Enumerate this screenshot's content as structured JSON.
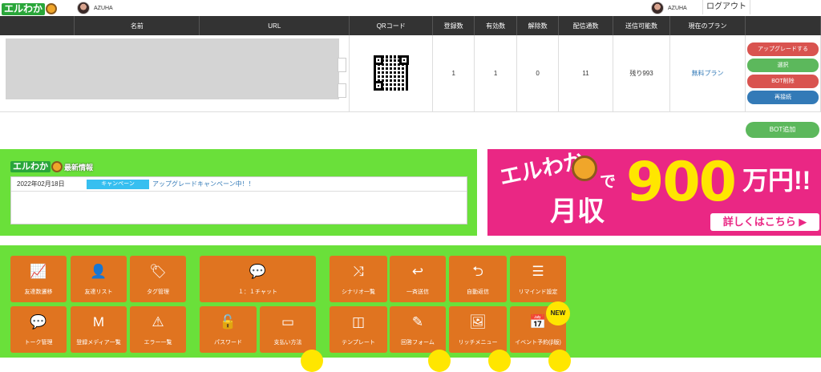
{
  "header": {
    "logo_text": "エルわか",
    "user_left": "AZUHA",
    "user_right": "AZUHA",
    "logout_label": "ログアウト"
  },
  "table": {
    "columns": [
      "名前",
      "URL",
      "QRコード",
      "登録数",
      "有効数",
      "解除数",
      "配信通数",
      "送信可能数",
      "現在のプラン"
    ],
    "row": {
      "registered": "1",
      "active": "1",
      "unsubscribed": "0",
      "deliveries": "11",
      "remaining": "残り993",
      "plan": "無料プラン"
    },
    "actions": {
      "upgrade": "アップグレードする",
      "select": "選択",
      "delete": "BOT削除",
      "reconnect": "再接続"
    },
    "add_bot": "BOT追加"
  },
  "news": {
    "logo_text": "エルわか",
    "title": "最新情報",
    "items": [
      {
        "date": "2022年02月18日",
        "tag": "キャンペーン",
        "text": "アップグレードキャンペーン中！！"
      }
    ]
  },
  "banner": {
    "line1": "エルわか",
    "de": "で",
    "income": "月収",
    "amount": "900",
    "unit": "万円!!",
    "cta": "詳しくはこちら ▶"
  },
  "menu": {
    "tiles": [
      {
        "label": "友達数遷移",
        "icon": "chart-line-icon"
      },
      {
        "label": "友達リスト",
        "icon": "person-icon"
      },
      {
        "label": "タグ管理",
        "icon": "tags-icon"
      },
      {
        "label": "１：１チャット",
        "icon": "chat-bubble-icon"
      },
      {
        "label": "シナリオ一覧",
        "icon": "shuffle-icon"
      },
      {
        "label": "一斉送信",
        "icon": "reply-icon"
      },
      {
        "label": "自動返信",
        "icon": "undo-arrow-icon"
      },
      {
        "label": "リマインド設定",
        "icon": "list-icon"
      },
      {
        "label": "トーク管理",
        "icon": "comment-icon"
      },
      {
        "label": "登録メディア一覧",
        "icon": "media-icon"
      },
      {
        "label": "エラー一覧",
        "icon": "warning-icon"
      },
      {
        "label": "パスワード",
        "icon": "unlock-icon"
      },
      {
        "label": "支払い方法",
        "icon": "card-icon"
      },
      {
        "label": "テンプレート",
        "icon": "columns-icon"
      },
      {
        "label": "回答フォーム",
        "icon": "form-icon"
      },
      {
        "label": "リッチメニュー",
        "icon": "image-icon"
      },
      {
        "label": "イベント予約(β版)",
        "icon": "calendar-icon"
      }
    ],
    "new_badge": "NEW"
  },
  "colors": {
    "green_bg": "#6ae03a",
    "tile_orange": "#e07420",
    "banner_pink": "#ea2784",
    "header_dark": "#333333"
  }
}
